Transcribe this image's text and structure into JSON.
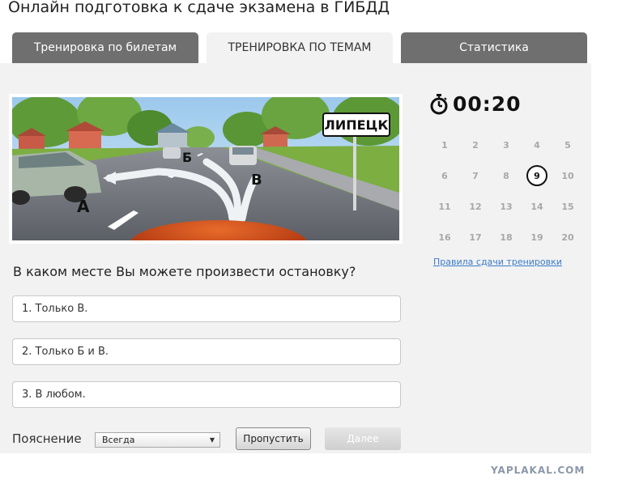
{
  "page": {
    "title": "Онлайн подготовка к сдаче экзамена в ГИБДД"
  },
  "tabs": [
    {
      "label": "Тренировка по билетам",
      "active": false
    },
    {
      "label": "ТРЕНИРОВКА ПО ТЕМАМ",
      "active": true
    },
    {
      "label": "Статистика",
      "active": false
    }
  ],
  "scene": {
    "sign_text": "ЛИПЕЦК",
    "labels": {
      "a": "А",
      "b": "Б",
      "v": "В"
    }
  },
  "question": {
    "text": "В каком месте Вы можете произвести остановку?"
  },
  "answers": [
    {
      "text": "1. Только В."
    },
    {
      "text": "2. Только Б и В."
    },
    {
      "text": "3. В любом."
    }
  ],
  "explanation": {
    "label": "Пояснение",
    "selected": "Всегда"
  },
  "buttons": {
    "skip": "Пропустить",
    "next": "Далее"
  },
  "timer": {
    "value": "00:20"
  },
  "grid": {
    "numbers": [
      "1",
      "2",
      "3",
      "4",
      "5",
      "6",
      "7",
      "8",
      "9",
      "10",
      "11",
      "12",
      "13",
      "14",
      "15",
      "16",
      "17",
      "18",
      "19",
      "20"
    ],
    "current": "9"
  },
  "rules_link": "Правила сдачи тренировки",
  "watermark": "YAPLAKAL.COM"
}
